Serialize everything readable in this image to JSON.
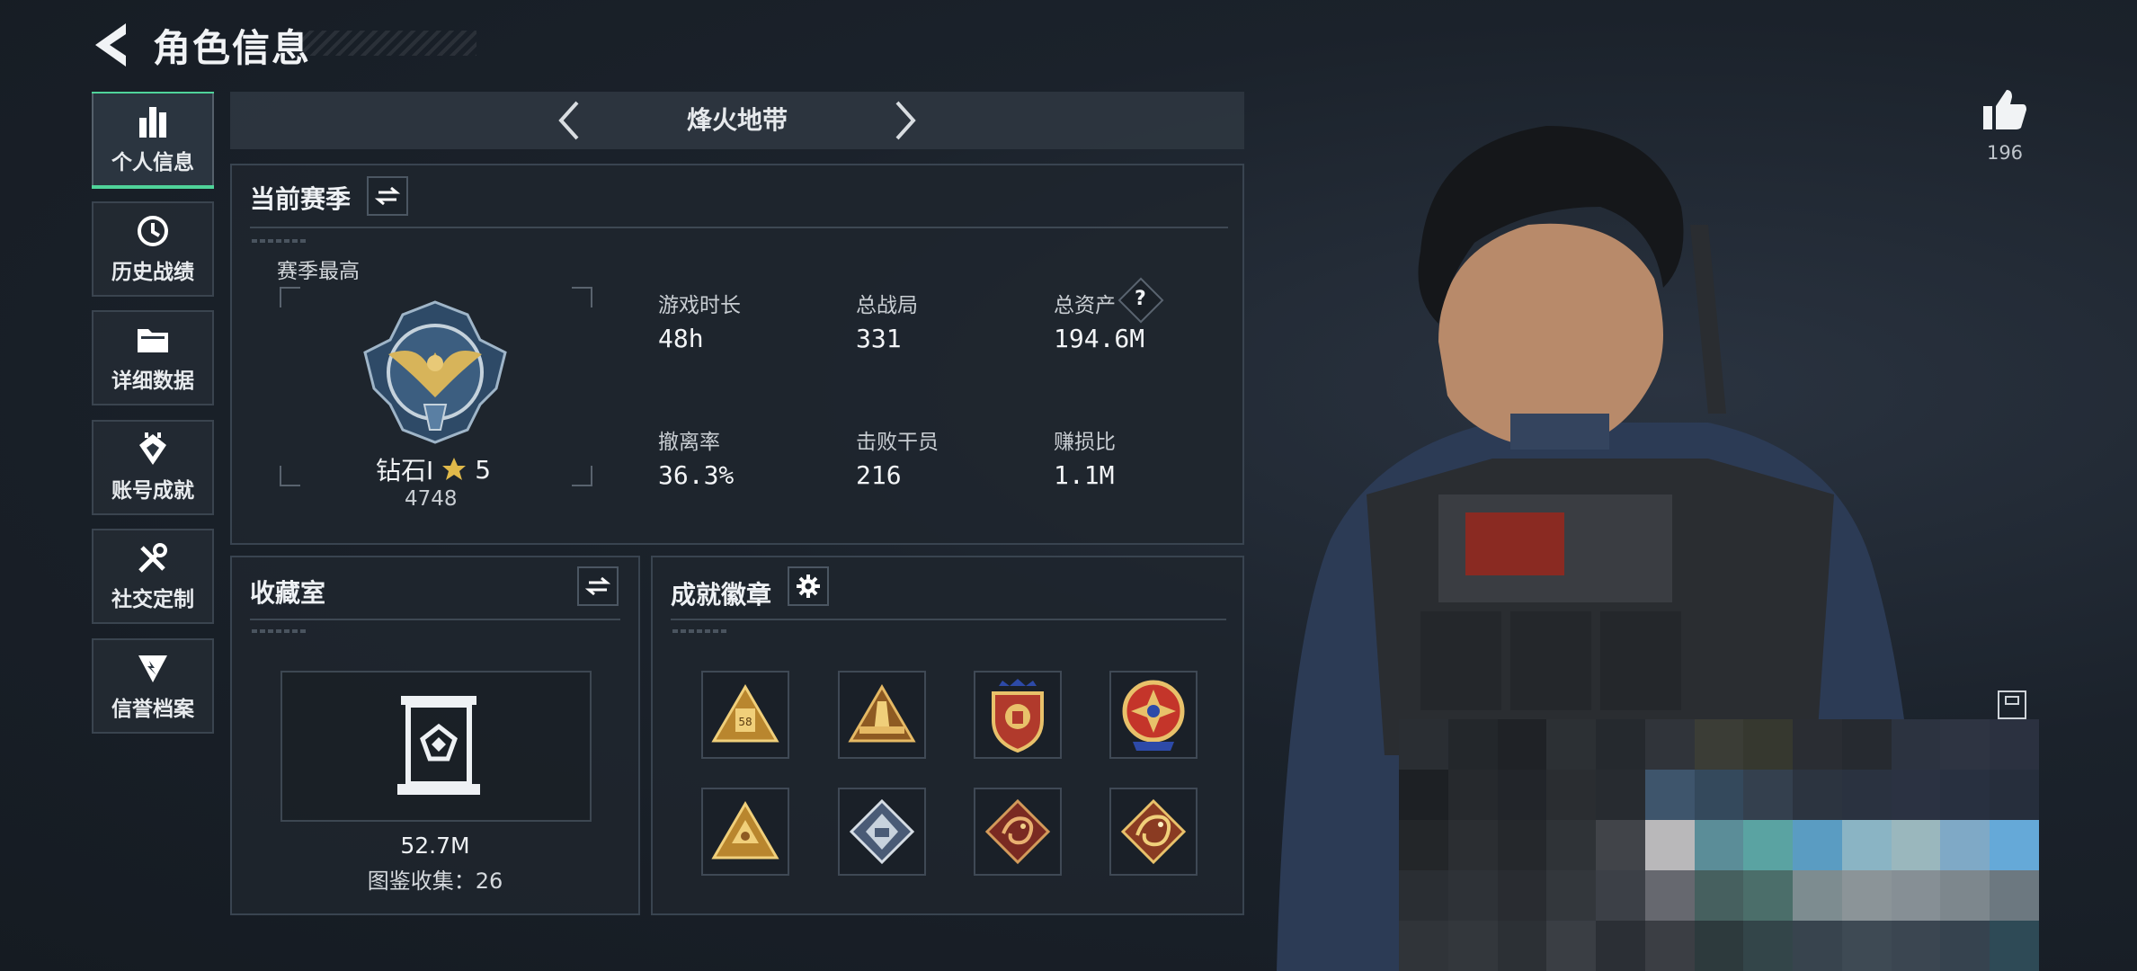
{
  "header": {
    "title": "角色信息",
    "back_icon": "chevron-left-icon"
  },
  "sidebar": {
    "items": [
      {
        "label": "个人信息",
        "icon": "bar-chart-icon",
        "active": true
      },
      {
        "label": "历史战绩",
        "icon": "history-clock-icon",
        "active": false
      },
      {
        "label": "详细数据",
        "icon": "folder-icon",
        "active": false
      },
      {
        "label": "账号成就",
        "icon": "achievement-icon",
        "active": false
      },
      {
        "label": "社交定制",
        "icon": "tools-icon",
        "active": false
      },
      {
        "label": "信誉档案",
        "icon": "shield-icon",
        "active": false
      }
    ]
  },
  "mode_selector": {
    "name": "烽火地带"
  },
  "season_panel": {
    "title": "当前赛季",
    "best_label": "赛季最高",
    "rank_name": "钻石I",
    "rank_stars": "5",
    "rank_points": "4748",
    "stats": [
      {
        "label": "游戏时长",
        "value": "48h"
      },
      {
        "label": "总战局",
        "value": "331"
      },
      {
        "label": "总资产",
        "value": "194.6M",
        "help": "?"
      },
      {
        "label": "撤离率",
        "value": "36.3%"
      },
      {
        "label": "击败干员",
        "value": "216"
      },
      {
        "label": "赚损比",
        "value": "1.1M"
      }
    ]
  },
  "collection_panel": {
    "title": "收藏室",
    "value": "52.7M",
    "count_text": "图鉴收集：26"
  },
  "badges_panel": {
    "title": "成就徽章",
    "badges": [
      "triangle-58-badge-icon",
      "triangle-tower-badge-icon",
      "shield-stars-badge-icon",
      "round-cross-badge-icon",
      "triangle-gold-badge-icon",
      "diamond-silver-badge-icon",
      "dragon-badge-icon",
      "dragon-gold-badge-icon"
    ]
  },
  "like": {
    "count": "196",
    "icon": "thumbs-up-icon"
  },
  "colors": {
    "accent": "#4fd39a",
    "gold": "#d7b45a",
    "panel": "#1f262e"
  }
}
